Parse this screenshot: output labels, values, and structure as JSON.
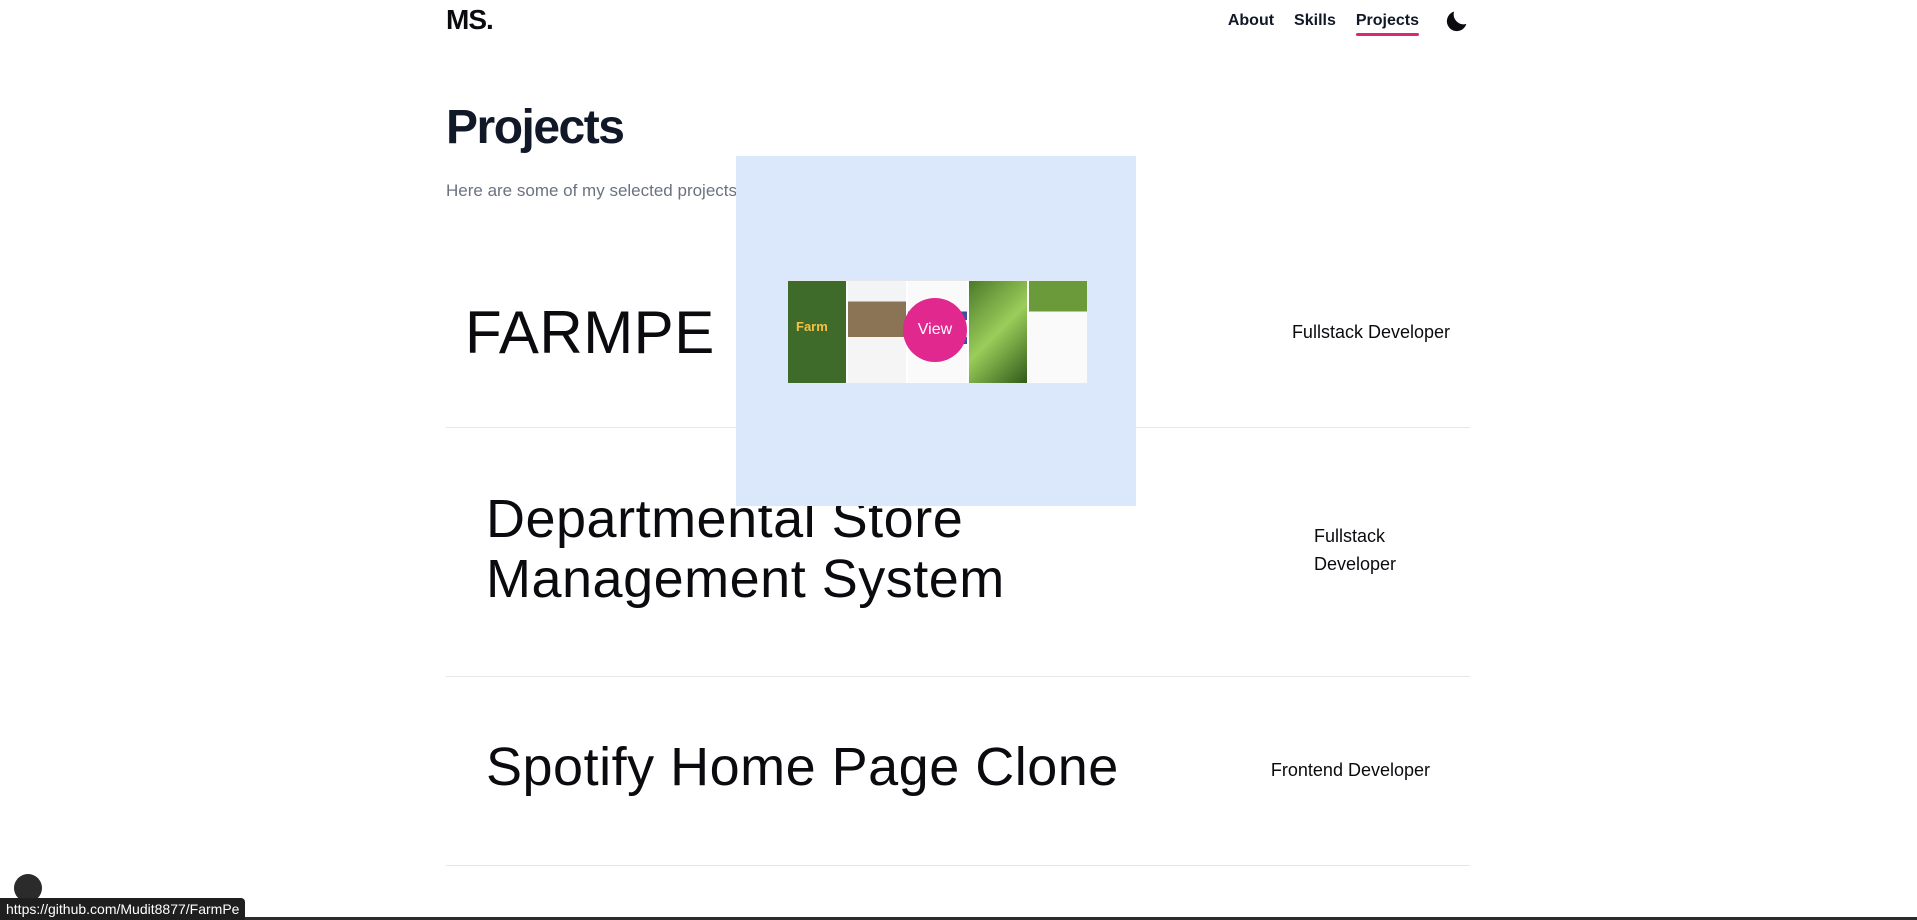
{
  "header": {
    "logo": "MS.",
    "nav": [
      {
        "label": "About"
      },
      {
        "label": "Skills"
      },
      {
        "label": "Projects",
        "active": true
      }
    ],
    "theme_toggle_icon": "moon-icon"
  },
  "main": {
    "title": "Projects",
    "subtitle": "Here are some of my selected projects",
    "projects": [
      {
        "name": "FARMPE",
        "role": "Fullstack Developer"
      },
      {
        "name": "Departmental Store Management System",
        "role": "Fullstack Developer"
      },
      {
        "name": "Spotify Home Page Clone",
        "role": "Frontend Developer"
      }
    ]
  },
  "preview": {
    "image_text": "Farm",
    "button_label": "View"
  },
  "status_bar": {
    "url": "https://github.com/Mudit8877/FarmPe"
  },
  "colors": {
    "accent": "#db2777",
    "preview_bg": "#dbe8fb",
    "view_button": "#e0288f"
  }
}
